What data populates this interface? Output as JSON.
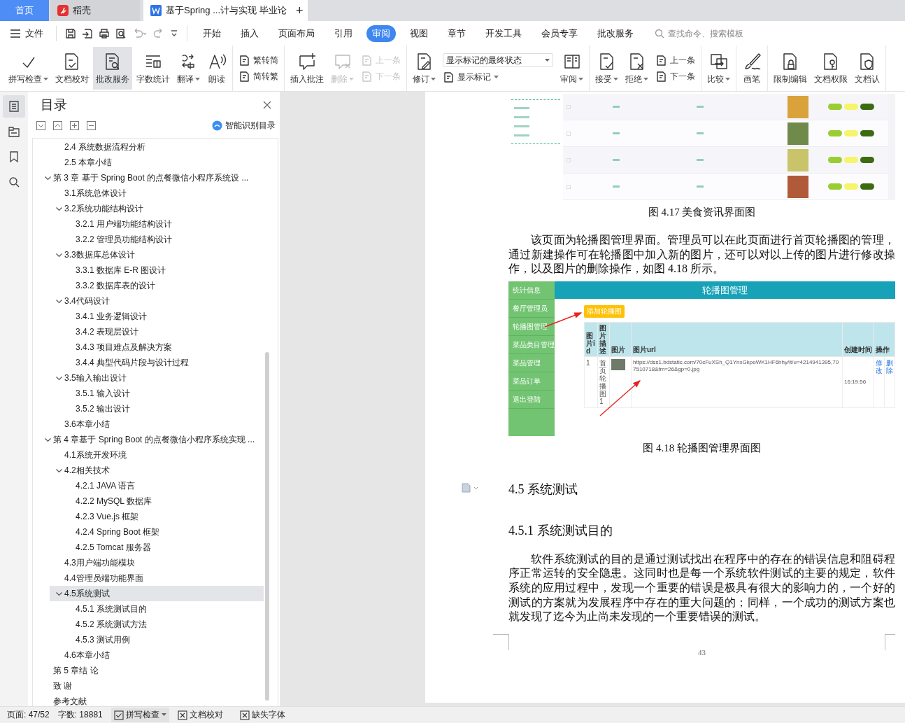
{
  "tab_bar": {
    "tabs": [
      {
        "kind": "home",
        "label": "首页",
        "selected": false
      },
      {
        "kind": "app",
        "label": "稻壳",
        "selected": false
      },
      {
        "kind": "document",
        "label": "基于Spring ...计与实现 毕业论",
        "selected": true
      }
    ],
    "new_tab": "+"
  },
  "menu_bar": {
    "file": "文件",
    "tabs": [
      {
        "label": "开始",
        "selected": false
      },
      {
        "label": "插入",
        "selected": false
      },
      {
        "label": "页面布局",
        "selected": false
      },
      {
        "label": "引用",
        "selected": false
      },
      {
        "label": "审阅",
        "selected": true
      },
      {
        "label": "视图",
        "selected": false
      },
      {
        "label": "章节",
        "selected": false
      },
      {
        "label": "开发工具",
        "selected": false
      },
      {
        "label": "会员专享",
        "selected": false
      },
      {
        "label": "批改服务",
        "selected": false
      }
    ],
    "search": {
      "placeholder": "查找命令、搜索模板"
    }
  },
  "ribbon": {
    "groups": [
      {
        "items": [
          {
            "kind": "large",
            "label": "拼写检查",
            "dropdown": true,
            "disabled": false,
            "selected": false
          },
          {
            "kind": "large",
            "label": "文档校对",
            "dropdown": false,
            "disabled": false,
            "selected": false
          },
          {
            "kind": "large",
            "label": "批改服务",
            "dropdown": false,
            "disabled": false,
            "selected": true
          },
          {
            "kind": "large",
            "label": "字数统计",
            "dropdown": false,
            "disabled": false,
            "selected": false
          },
          {
            "kind": "large",
            "label": "翻译",
            "dropdown": true,
            "disabled": false,
            "selected": false
          },
          {
            "kind": "large",
            "label": "朗读",
            "dropdown": false,
            "disabled": false,
            "selected": false
          }
        ]
      },
      {
        "items": [
          {
            "kind": "stack",
            "children": [
              {
                "kind": "small",
                "label": "繁转简",
                "dropdown": false,
                "disabled": false
              },
              {
                "kind": "small",
                "label": "简转繁",
                "dropdown": false,
                "disabled": false
              }
            ]
          }
        ]
      },
      {
        "items": [
          {
            "kind": "large",
            "label": "插入批注",
            "dropdown": false,
            "disabled": false,
            "selected": false
          },
          {
            "kind": "large",
            "label": "删除",
            "dropdown": true,
            "disabled": true,
            "selected": false
          },
          {
            "kind": "stack",
            "children": [
              {
                "kind": "small",
                "label": "上一条",
                "dropdown": false,
                "disabled": true
              },
              {
                "kind": "small",
                "label": "下一条",
                "dropdown": false,
                "disabled": true
              }
            ]
          }
        ]
      },
      {
        "items": [
          {
            "kind": "large",
            "label": "修订",
            "dropdown": true,
            "disabled": false,
            "selected": false
          },
          {
            "kind": "stack",
            "children": [
              {
                "kind": "select",
                "label": "显示标记的最终状态",
                "dropdown": true
              },
              {
                "kind": "small",
                "label": "显示标记",
                "dropdown": true,
                "disabled": false
              }
            ]
          },
          {
            "kind": "large",
            "label": "审阅",
            "dropdown": true,
            "disabled": false,
            "selected": false
          }
        ]
      },
      {
        "items": [
          {
            "kind": "large",
            "label": "接受",
            "dropdown": true,
            "disabled": false,
            "selected": false
          },
          {
            "kind": "large",
            "label": "拒绝",
            "dropdown": true,
            "disabled": false,
            "selected": false
          },
          {
            "kind": "stack",
            "children": [
              {
                "kind": "small",
                "label": "上一条",
                "dropdown": false,
                "disabled": false
              },
              {
                "kind": "small",
                "label": "下一条",
                "dropdown": false,
                "disabled": false
              }
            ]
          }
        ]
      },
      {
        "items": [
          {
            "kind": "large",
            "label": "比较",
            "dropdown": true,
            "disabled": false,
            "selected": false
          }
        ]
      },
      {
        "items": [
          {
            "kind": "large",
            "label": "画笔",
            "dropdown": false,
            "disabled": false,
            "selected": false
          }
        ]
      },
      {
        "items": [
          {
            "kind": "large",
            "label": "限制编辑",
            "dropdown": false,
            "disabled": false,
            "selected": false
          },
          {
            "kind": "large",
            "label": "文档权限",
            "dropdown": false,
            "disabled": false,
            "selected": false
          },
          {
            "kind": "large",
            "label": "文档认",
            "dropdown": false,
            "disabled": false,
            "selected": false
          }
        ]
      }
    ]
  },
  "side_rail": {
    "items": [
      {
        "selected": true
      },
      {
        "selected": false
      },
      {
        "selected": false
      },
      {
        "selected": false
      }
    ]
  },
  "outline_panel": {
    "title": "目录",
    "smart_button": "智能识别目录",
    "tree": [
      {
        "expanded": true,
        "children": [
          {
            "label": "2.4 系统数据流程分析",
            "selected": false
          },
          {
            "label": "2.5 本章小结",
            "selected": false
          }
        ]
      },
      {
        "label": "第 3 章  基于 Spring Boot 的点餐微信小程序系统设 ...",
        "selected": false,
        "expanded": true,
        "children": [
          {
            "label": "3.1系统总体设计",
            "selected": false
          },
          {
            "label": "3.2系统功能结构设计",
            "selected": false,
            "expanded": true,
            "children": [
              {
                "label": "3.2.1 用户端功能结构设计",
                "selected": false
              },
              {
                "label": "3.2.2 管理员功能结构设计",
                "selected": false
              }
            ]
          },
          {
            "label": "3.3数据库总体设计",
            "selected": false,
            "expanded": true,
            "children": [
              {
                "label": "3.3.1  数据库 E-R 图设计",
                "selected": false
              },
              {
                "label": "3.3.2  数据库表的设计",
                "selected": false
              }
            ]
          },
          {
            "label": "3.4代码设计",
            "selected": false,
            "expanded": true,
            "children": [
              {
                "label": "3.4.1 业务逻辑设计",
                "selected": false
              },
              {
                "label": "3.4.2 表现层设计",
                "selected": false
              },
              {
                "label": "3.4.3 项目难点及解决方案",
                "selected": false
              },
              {
                "label": "3.4.4 典型代码片段与设计过程",
                "selected": false
              }
            ]
          },
          {
            "label": "3.5输入输出设计",
            "selected": false,
            "expanded": true,
            "children": [
              {
                "label": "3.5.1 输入设计",
                "selected": false
              },
              {
                "label": "3.5.2 输出设计",
                "selected": false
              }
            ]
          },
          {
            "label": "3.6本章小结",
            "selected": false
          }
        ]
      },
      {
        "label": "第 4 章基于 Spring Boot 的点餐微信小程序系统实现 ...",
        "selected": false,
        "expanded": true,
        "children": [
          {
            "label": "4.1系统开发环境",
            "selected": false
          },
          {
            "label": "4.2相关技术",
            "selected": false,
            "expanded": true,
            "children": [
              {
                "label": "4.2.1 JAVA 语言",
                "selected": false
              },
              {
                "label": "4.2.2 MySQL 数据库",
                "selected": false
              },
              {
                "label": "4.2.3 Vue.js 框架",
                "selected": false
              },
              {
                "label": "4.2.4 Spring Boot 框架",
                "selected": false
              },
              {
                "label": "4.2.5 Tomcat 服务器",
                "selected": false
              }
            ]
          },
          {
            "label": "4.3用户端功能模块",
            "selected": false
          },
          {
            "label": "4.4管理员端功能界面",
            "selected": false
          },
          {
            "label": "4.5系统测试",
            "selected": true,
            "expanded": true,
            "children": [
              {
                "label": "4.5.1  系统测试目的",
                "selected": false
              },
              {
                "label": "4.5.2  系统测试方法",
                "selected": false
              },
              {
                "label": "4.5.3  测试用例",
                "selected": false
              }
            ]
          },
          {
            "label": "4.6本章小结",
            "selected": false
          }
        ]
      },
      {
        "label": "第 5 章结   论",
        "selected": false
      },
      {
        "label": "致   谢",
        "selected": false
      },
      {
        "label": "参考文献",
        "selected": false
      }
    ]
  },
  "document": {
    "blocks": [
      {
        "kind": "list_screenshot"
      },
      {
        "kind": "caption",
        "text": "图 4.17 美食资讯界面图"
      },
      {
        "kind": "paragraph",
        "text": "该页面为轮播图管理界面。管理员可以在此页面进行首页轮播图的管理，通过新建操作可在轮播图中加入新的图片，还可以对以上传的图片进行修改操作，以及图片的删除操作，如图 4.18 所示。"
      },
      {
        "kind": "admin_screenshot",
        "sidebar": [
          "统计信息",
          "餐厅管理员",
          "轮播图管理",
          "菜品类目管理",
          "菜品管理",
          "菜品订单",
          "退出登陆"
        ],
        "header": "轮播图管理",
        "add_button": "添加轮播图",
        "columns": [
          "图片id",
          "图片描述",
          "图片",
          "图片url",
          "创建时间",
          "操作"
        ],
        "rows": [
          {
            "id": "1",
            "description": "首页轮播图1",
            "url": "https://dss1.bdstatic.com/70cFuXSh_Q1YnxGkpoWK1HF6hhy/it/u=4214941395,707510718&fm=26&gp=0.jpg",
            "time": "16:19:56",
            "actions": [
              "修改",
              "删除"
            ]
          }
        ]
      },
      {
        "kind": "caption",
        "text": "图 4.18  轮播图管理界面图"
      },
      {
        "kind": "heading",
        "text": "4.5  系统测试"
      },
      {
        "kind": "subheading",
        "text": "4.5.1  系统测试目的"
      },
      {
        "kind": "paragraph",
        "text": "软件系统测试的目的是通过测试找出在程序中的存在的错误信息和阻碍程序正常运转的安全隐患。这同时也是每一个系统软件测试的主要的规定，软件系统的应用过程中，发现一个重要的错误是极具有很大的影响力的，一个好的测试的方案就为发展程序中存在的重大问题的；同样，一个成功的测试方案也就发现了迄今为止尚未发现的一个重要错误的测试。"
      }
    ],
    "page_number": "43"
  },
  "status_bar": {
    "page": "页面: 47/52",
    "words": "字数: 18881",
    "buttons": [
      {
        "label": "拼写检查",
        "dropdown": true
      },
      {
        "label": "文档校对",
        "dropdown": false
      },
      {
        "label": "缺失字体",
        "dropdown": false
      }
    ]
  }
}
